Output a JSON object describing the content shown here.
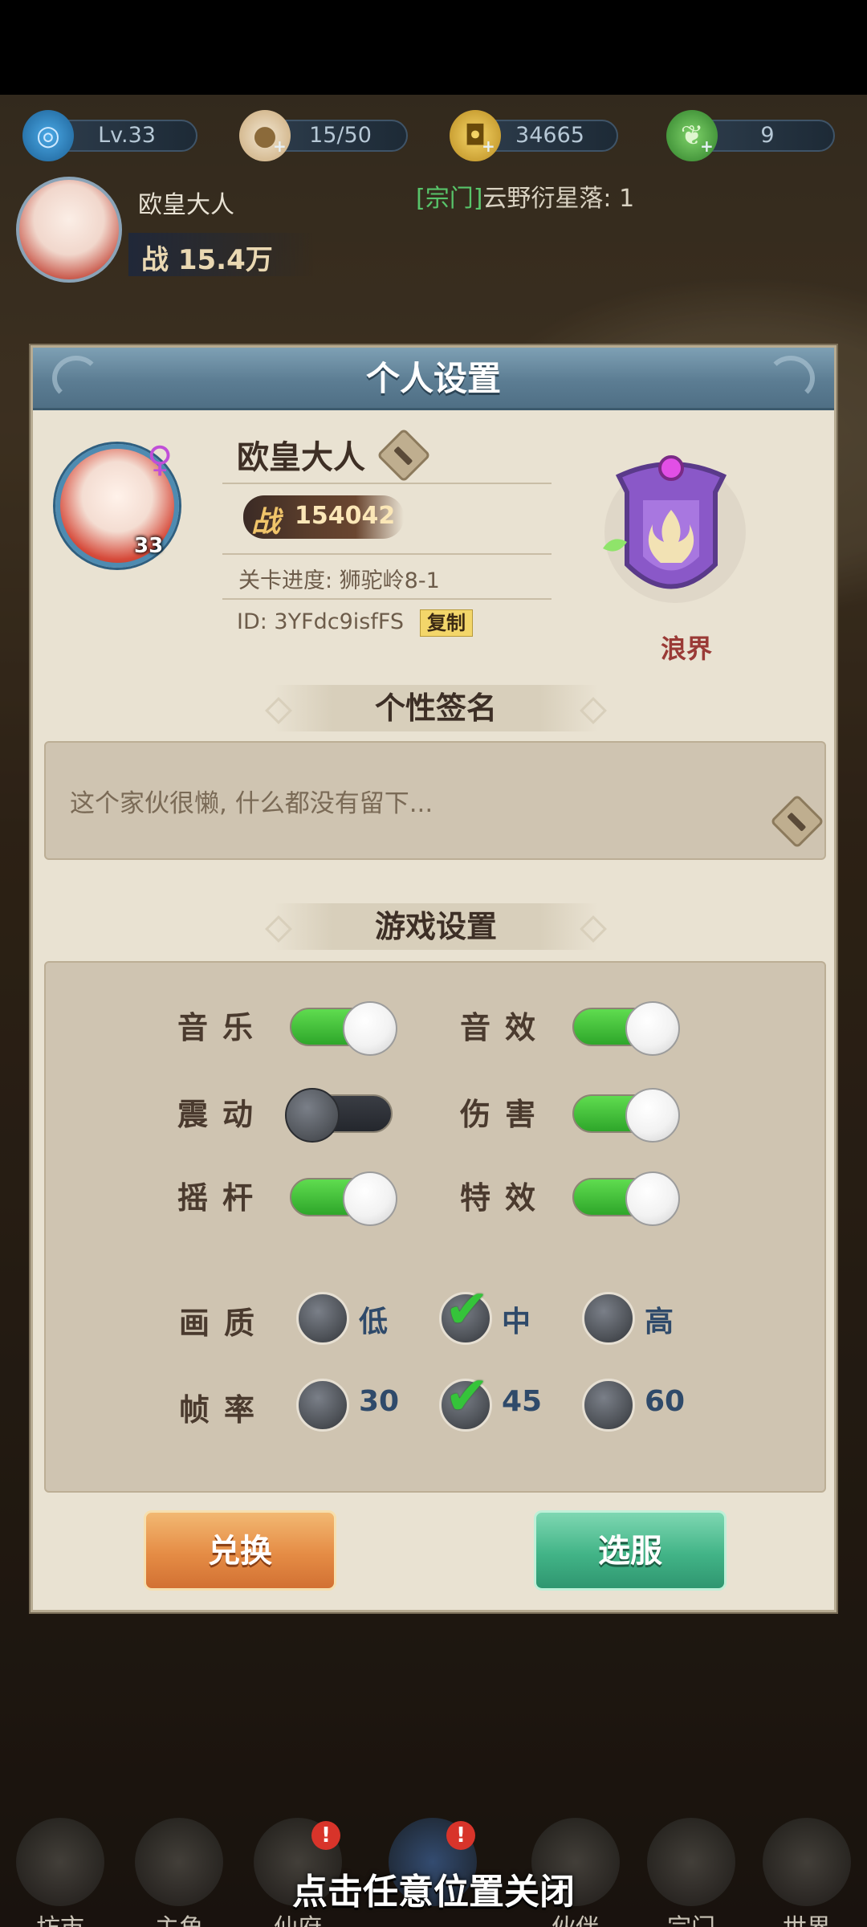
{
  "resources": [
    {
      "icon": "swirl-icon",
      "value": "Lv.33"
    },
    {
      "icon": "bun-icon",
      "value": "15/50"
    },
    {
      "icon": "coin-icon",
      "value": "34665"
    },
    {
      "icon": "leaf-icon",
      "value": "9"
    }
  ],
  "player_header": {
    "name": "欧皇大人",
    "power": "战 15.4万",
    "guild_tag": "[宗门]",
    "guild_text": "云野衍星落: 1"
  },
  "modal": {
    "title": "个人设置",
    "profile": {
      "level": "33",
      "name": "欧皇大人",
      "power_label": "战",
      "power_value": "154042",
      "stage": "关卡进度: 狮驼岭8-1",
      "id": "ID: 3YFdc9isfFS",
      "copy_label": "复制",
      "emblem_name": "浪界"
    },
    "signature": {
      "title": "个性签名",
      "text": "这个家伙很懒, 什么都没有留下..."
    },
    "game_settings": {
      "title": "游戏设置",
      "toggles": [
        {
          "label": "音乐",
          "on": true
        },
        {
          "label": "音效",
          "on": true
        },
        {
          "label": "震动",
          "on": false
        },
        {
          "label": "伤害",
          "on": true
        },
        {
          "label": "摇杆",
          "on": true
        },
        {
          "label": "特效",
          "on": true
        }
      ],
      "quality": {
        "label": "画质",
        "options": [
          "低",
          "中",
          "高"
        ],
        "selected": "中"
      },
      "framerate": {
        "label": "帧率",
        "options": [
          "30",
          "45",
          "60"
        ],
        "selected": "45"
      }
    },
    "buttons": {
      "exchange": "兑换",
      "server": "选服"
    }
  },
  "bottom_nav": [
    {
      "label": "坊市",
      "badge": ""
    },
    {
      "label": "主角",
      "badge": ""
    },
    {
      "label": "仙府",
      "badge": "!"
    },
    {
      "label": "",
      "badge": "!"
    },
    {
      "label": "伙伴",
      "badge": ""
    },
    {
      "label": "宗门",
      "badge": ""
    },
    {
      "label": "世界",
      "badge": ""
    }
  ],
  "close_hint": "点击任意位置关闭",
  "colors": {
    "toggle_on": "#3cc43a",
    "accent_title": "#5c7d93"
  }
}
